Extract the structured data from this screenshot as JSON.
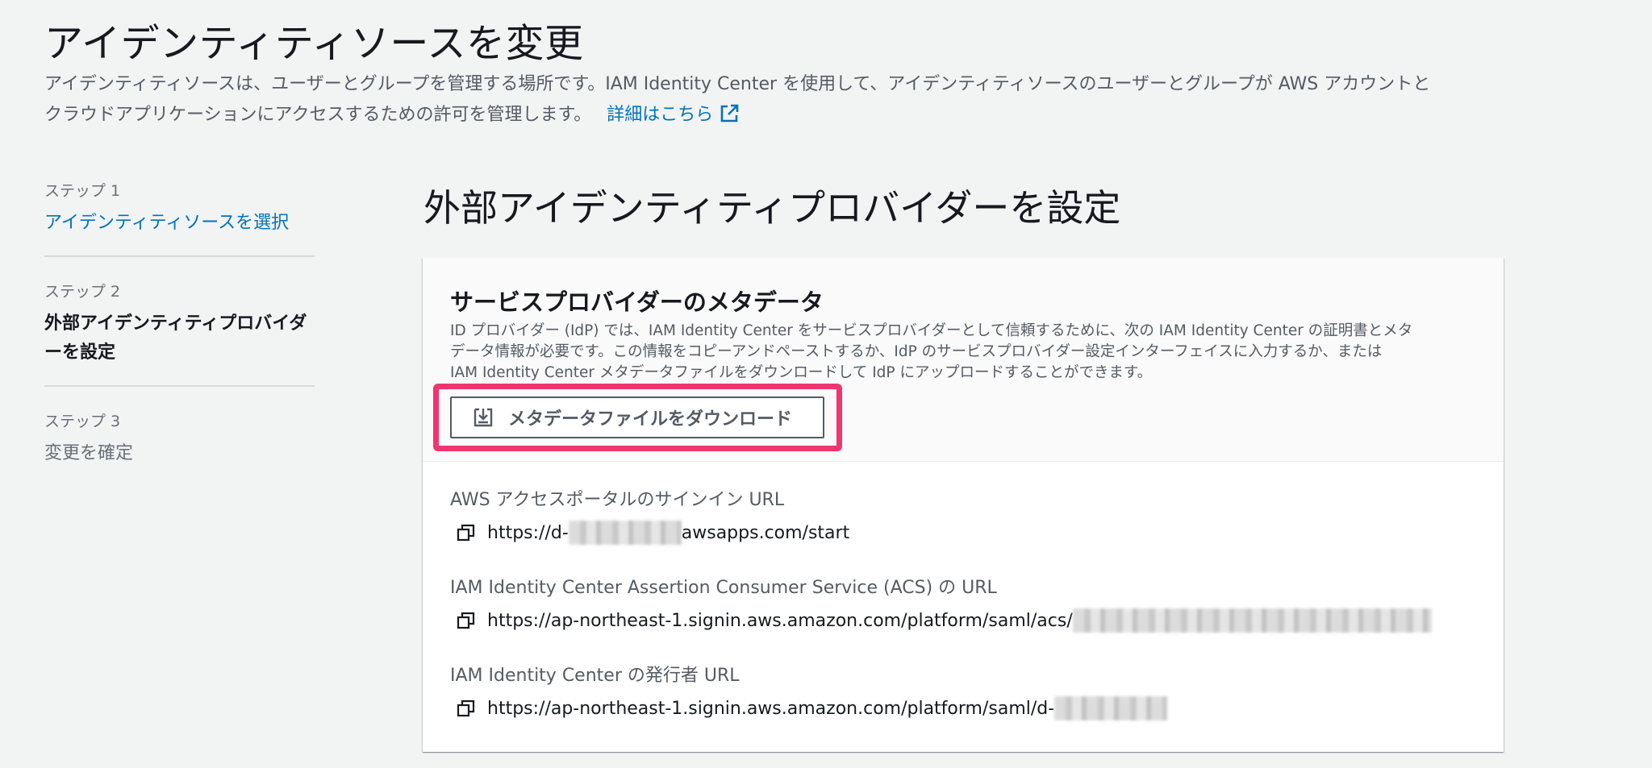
{
  "header": {
    "title": "アイデンティティソースを変更",
    "description_line1": "アイデンティティソースは、ユーザーとグループを管理する場所です。IAM Identity Center を使用して、アイデンティティソースのユーザーとグループが AWS アカウントと",
    "description_line2": "クラウドアプリケーションにアクセスするための許可を管理します。",
    "learn_more": "詳細はこちら"
  },
  "steps": [
    {
      "number": "ステップ 1",
      "label": "アイデンティティソースを選択",
      "state": "link"
    },
    {
      "number": "ステップ 2",
      "label": "外部アイデンティティプロバイダーを設定",
      "state": "current"
    },
    {
      "number": "ステップ 3",
      "label": "変更を確定",
      "state": "disabled"
    }
  ],
  "main": {
    "title": "外部アイデンティティプロバイダーを設定"
  },
  "metadata_card": {
    "title": "サービスプロバイダーのメタデータ",
    "description_line1": "ID プロバイダー (IdP) では、IAM Identity Center をサービスプロバイダーとして信頼するために、次の IAM Identity Center の証明書とメタ",
    "description_line2": "データ情報が必要です。この情報をコピーアンドペーストするか、IdP のサービスプロバイダー設定インターフェイスに入力するか、または",
    "description_line3": "IAM Identity Center メタデータファイルをダウンロードして IdP にアップロードすることができます。",
    "download_button": "メタデータファイルをダウンロード",
    "highlight_color": "#f0356f"
  },
  "urls": [
    {
      "label": "AWS アクセスポータルのサインイン URL",
      "prefix": "https://d-",
      "suffix": "awsapps.com/start"
    },
    {
      "label": "IAM Identity Center Assertion Consumer Service (ACS) の URL",
      "prefix": "https://ap-northeast-1.signin.aws.amazon.com/platform/saml/acs/",
      "suffix": ""
    },
    {
      "label": "IAM Identity Center の発行者 URL",
      "prefix": "https://ap-northeast-1.signin.aws.amazon.com/platform/saml/d-",
      "suffix": ""
    }
  ],
  "colors": {
    "link": "#0073bb",
    "background": "#f2f3f3",
    "text": "#16191f",
    "secondary_text": "#545b64"
  }
}
